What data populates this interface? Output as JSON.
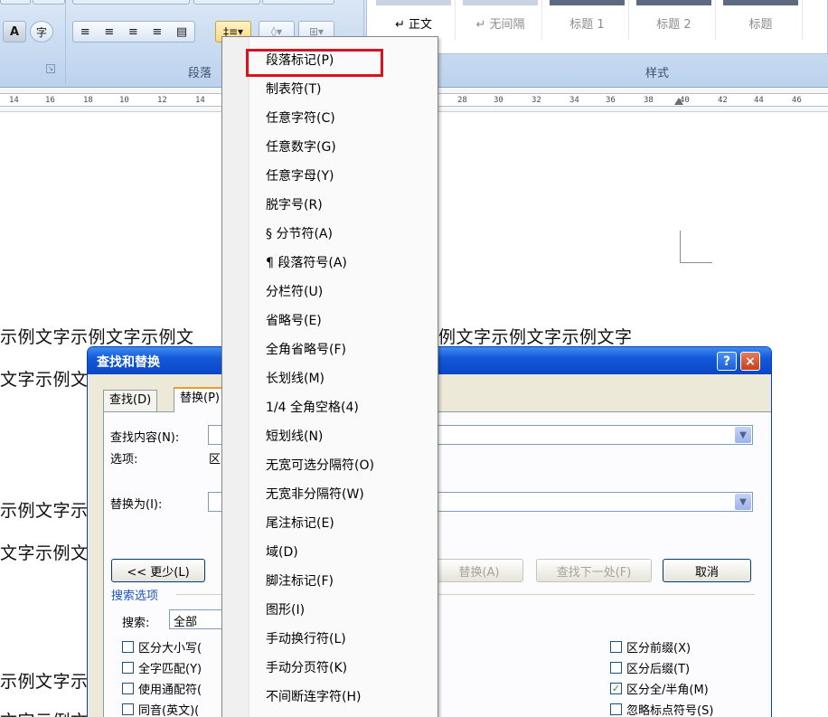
{
  "ribbon": {
    "font_buttons": [
      {
        "label": "A",
        "icon": "character-shading-icon"
      },
      {
        "label": "字",
        "icon": "enclose-characters-icon"
      }
    ],
    "paragraph_group_label": "段落",
    "styles_group_label": "样式",
    "paragraph_buttons": [
      {
        "icon": "align-left-icon",
        "glyph": "≡"
      },
      {
        "icon": "align-center-icon",
        "glyph": "≡"
      },
      {
        "icon": "align-right-icon",
        "glyph": "≡"
      },
      {
        "icon": "justify-icon",
        "glyph": "≡"
      },
      {
        "icon": "distributed-icon",
        "glyph": "▤"
      },
      {
        "icon": "line-spacing-icon",
        "glyph": "‡≡▾"
      },
      {
        "icon": "shading-icon",
        "glyph": "◊▾"
      },
      {
        "icon": "borders-icon",
        "glyph": "⊞▾"
      }
    ],
    "styles": [
      {
        "label": "↵ 正文",
        "active": true
      },
      {
        "label": "↵ 无间隔",
        "active": false
      },
      {
        "label": "标题 1",
        "active": false
      },
      {
        "label": "标题 2",
        "active": false
      },
      {
        "label": "标题",
        "active": false
      }
    ]
  },
  "ruler": {
    "ticks": [
      "14",
      "16",
      "18",
      "10",
      "12",
      "14",
      "28",
      "30",
      "32",
      "34",
      "36",
      "38",
      "40",
      "42",
      "44",
      "46"
    ]
  },
  "document": {
    "lines": [
      "示例文字示例文字示例文",
      "例文字示例文字示例文字",
      "文字示例文",
      "示例文字示",
      "文字示例文",
      "示例文字示",
      "文字示例文"
    ]
  },
  "dialog": {
    "title": "查找和替换",
    "help_label": "?",
    "close_label": "×",
    "tabs": {
      "find": "查找(D)",
      "replace": "替换(P)"
    },
    "find_what_label": "查找内容(N):",
    "options_label": "选项:",
    "options_value": "区",
    "replace_with_label": "替换为(I):",
    "less_button": "<< 更少(L)",
    "replace_all_button": "替换(A)",
    "find_next_button": "查找下一处(F)",
    "cancel_button": "取消",
    "search_options_title": "搜索选项",
    "search_label": "搜索:",
    "search_value": "全部",
    "left_options": [
      {
        "label": "区分大小写(",
        "checked": false
      },
      {
        "label": "全字匹配(Y)",
        "checked": false
      },
      {
        "label": "使用通配符(",
        "checked": false
      },
      {
        "label": "同音(英文)(",
        "checked": false
      }
    ],
    "right_options": [
      {
        "label": "区分前缀(X)",
        "checked": false
      },
      {
        "label": "区分后缀(T)",
        "checked": false
      },
      {
        "label": "区分全/半角(M)",
        "checked": true
      },
      {
        "label": "忽略标点符号(S)",
        "checked": false
      }
    ]
  },
  "menu": {
    "items": [
      "段落标记(P)",
      "制表符(T)",
      "任意字符(C)",
      "任意数字(G)",
      "任意字母(Y)",
      "脱字号(R)",
      "§ 分节符(A)",
      "¶ 段落符号(A)",
      "分栏符(U)",
      "省略号(E)",
      "全角省略号(F)",
      "长划线(M)",
      "1/4 全角空格(4)",
      "短划线(N)",
      "无宽可选分隔符(O)",
      "无宽非分隔符(W)",
      "尾注标记(E)",
      "域(D)",
      "脚注标记(F)",
      "图形(I)",
      "手动换行符(L)",
      "手动分页符(K)",
      "不间断连字符(H)"
    ]
  }
}
